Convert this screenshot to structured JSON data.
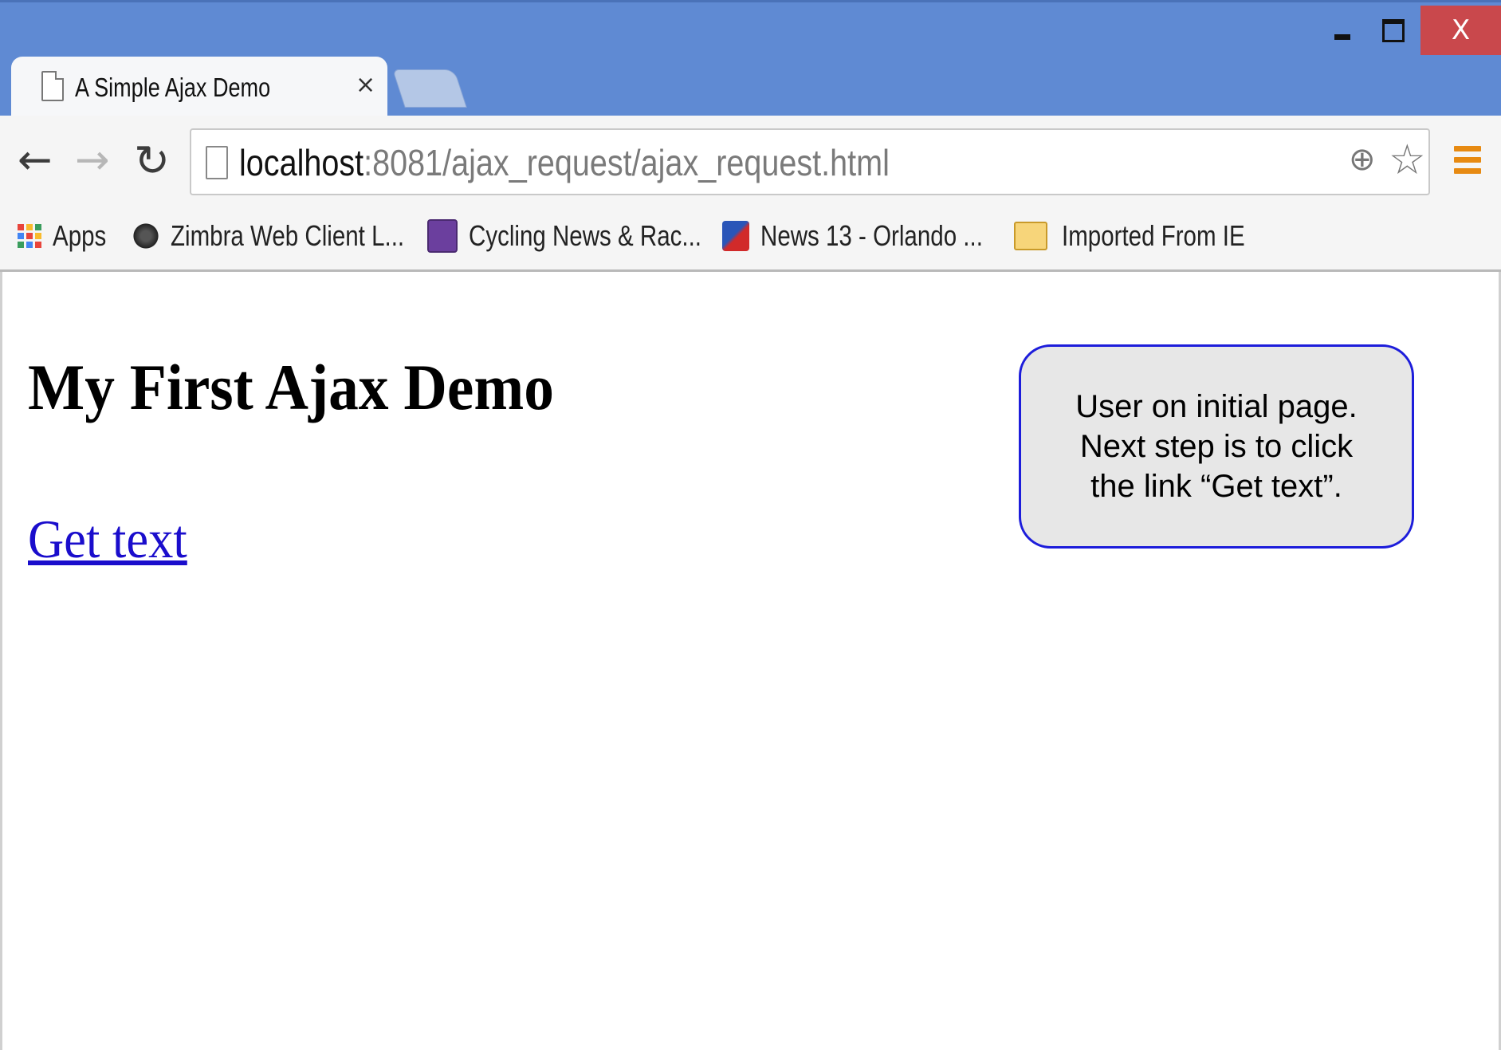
{
  "tab": {
    "title": "A Simple Ajax Demo",
    "close": "×"
  },
  "window_controls": {
    "close": "X"
  },
  "nav": {
    "back": "←",
    "forward": "→",
    "reload": "↻"
  },
  "address_bar": {
    "host": "localhost",
    "path": ":8081/ajax_request/ajax_request.html"
  },
  "omnibox_icons": {
    "zoom": "⊕",
    "star": "☆"
  },
  "bookmarks": [
    {
      "label": "Apps",
      "icon": "apps-grid-icon"
    },
    {
      "label": "Zimbra Web Client L...",
      "icon": "zimbra-icon"
    },
    {
      "label": "Cycling News & Rac...",
      "icon": "cycling-icon"
    },
    {
      "label": "News 13 - Orlando ...",
      "icon": "news13-icon"
    },
    {
      "label": "Imported From IE",
      "icon": "folder-icon"
    }
  ],
  "page": {
    "heading": "My First Ajax Demo",
    "link": "Get text"
  },
  "callout": {
    "line1": "User on initial page.",
    "line2": "Next step is to click",
    "line3": "the link “Get text”."
  },
  "colors": {
    "titlebar": "#5f8ad3",
    "close_button": "#c9484c",
    "link": "#1a0dcc",
    "callout_border": "#1d1ddb",
    "callout_fill": "#e7e7e7",
    "menu_icon": "#e78a12"
  }
}
